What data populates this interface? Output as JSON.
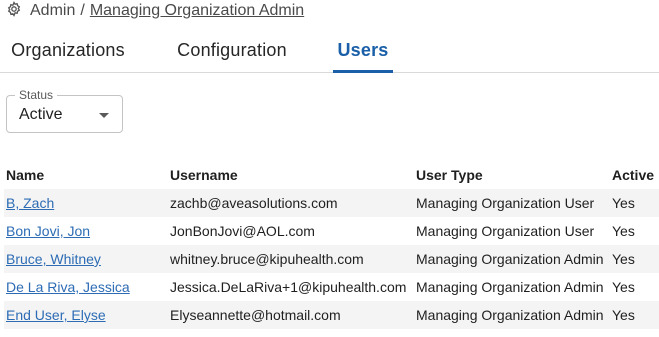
{
  "breadcrumb": {
    "icon": "gear-icon",
    "root": "Admin",
    "separator": "/",
    "current": "Managing Organization Admin"
  },
  "tabs": [
    {
      "label": "Organizations",
      "active": false
    },
    {
      "label": "Configuration",
      "active": false
    },
    {
      "label": "Users",
      "active": true
    }
  ],
  "filter": {
    "label": "Status",
    "value": "Active"
  },
  "table": {
    "columns": [
      "Name",
      "Username",
      "User Type",
      "Active"
    ],
    "rows": [
      {
        "name": "B, Zach",
        "username": "zachb@aveasolutions.com",
        "type": "Managing Organization User",
        "active": "Yes"
      },
      {
        "name": "Bon Jovi, Jon",
        "username": "JonBonJovi@AOL.com",
        "type": "Managing Organization User",
        "active": "Yes"
      },
      {
        "name": "Bruce, Whitney",
        "username": "whitney.bruce@kipuhealth.com",
        "type": "Managing Organization Admin",
        "active": "Yes"
      },
      {
        "name": "De La Riva, Jessica",
        "username": "Jessica.DeLaRiva+1@kipuhealth.com",
        "type": "Managing Organization Admin",
        "active": "Yes"
      },
      {
        "name": "End User, Elyse",
        "username": "Elyseannette@hotmail.com",
        "type": "Managing Organization Admin",
        "active": "Yes"
      }
    ]
  },
  "colors": {
    "accent": "#1a5fa8",
    "link": "#2d6cb5",
    "row_stripe": "#f4f4f4"
  }
}
